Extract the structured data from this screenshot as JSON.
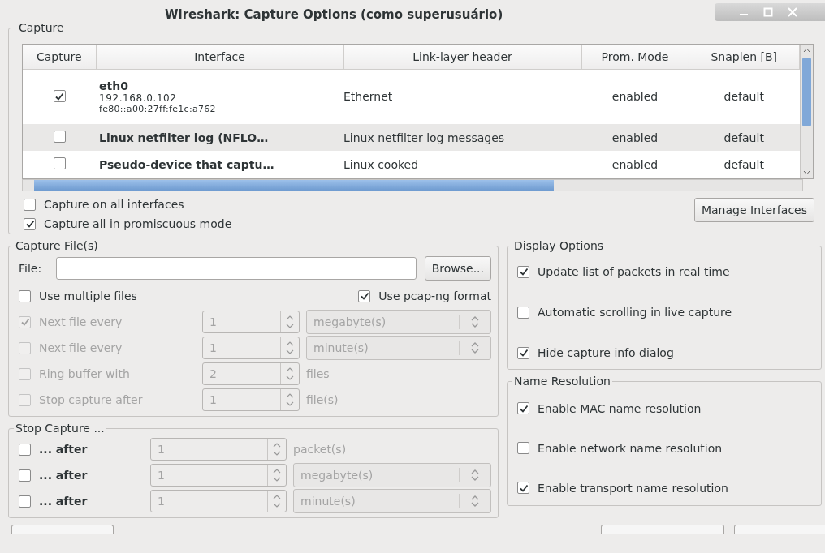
{
  "window": {
    "title": "Wireshark: Capture Options (como superusuário)"
  },
  "capture": {
    "label": "Capture",
    "columns": [
      "Capture",
      "Interface",
      "Link-layer header",
      "Prom. Mode",
      "Snaplen [B]"
    ],
    "rows": [
      {
        "checked": true,
        "interface": "eth0",
        "addresses": [
          "192.168.0.102",
          "fe80::a00:27ff:fe1c:a762"
        ],
        "link_layer": "Ethernet",
        "prom_mode": "enabled",
        "snaplen": "default"
      },
      {
        "checked": false,
        "interface": "Linux netfilter log (NFLO…",
        "addresses": [],
        "link_layer": "Linux netfilter log messages",
        "prom_mode": "enabled",
        "snaplen": "default"
      },
      {
        "checked": false,
        "interface": "Pseudo-device that captu…",
        "addresses": [],
        "link_layer": "Linux cooked",
        "prom_mode": "enabled",
        "snaplen": "default"
      }
    ],
    "options": [
      {
        "label": "Capture on all interfaces",
        "checked": false
      },
      {
        "label": "Capture all in promiscuous mode",
        "checked": true
      }
    ],
    "manage_button": "Manage Interfaces"
  },
  "capture_files": {
    "label": "Capture File(s)",
    "file_label": "File:",
    "browse_button": "Browse...",
    "multiple_files": {
      "label": "Use multiple files",
      "checked": false
    },
    "pcapng": {
      "label": "Use pcap-ng format",
      "checked": true
    },
    "rows": [
      {
        "label": "Next file every",
        "checked": true,
        "disabled": true,
        "spin": {
          "value": "1",
          "disabled": true
        },
        "unit": {
          "kind": "combo",
          "text": "megabyte(s)"
        }
      },
      {
        "label": "Next file every",
        "checked": false,
        "disabled": true,
        "spin": {
          "value": "1",
          "disabled": true
        },
        "unit": {
          "kind": "combo",
          "text": "minute(s)"
        }
      },
      {
        "label": "Ring buffer with",
        "checked": false,
        "disabled": true,
        "spin": {
          "value": "2",
          "disabled": true
        },
        "unit": {
          "kind": "text",
          "text": "files"
        }
      },
      {
        "label": "Stop capture after",
        "checked": false,
        "disabled": true,
        "spin": {
          "value": "1",
          "disabled": true
        },
        "unit": {
          "kind": "text",
          "text": "file(s)"
        }
      }
    ]
  },
  "stop_capture": {
    "label": "Stop Capture ...",
    "rows": [
      {
        "label": "... after",
        "checked": false,
        "disabled": false,
        "spin": {
          "value": "1",
          "disabled": true
        },
        "unit": {
          "kind": "text",
          "text": "packet(s)"
        }
      },
      {
        "label": "... after",
        "checked": false,
        "disabled": false,
        "spin": {
          "value": "1",
          "disabled": true
        },
        "unit": {
          "kind": "combo",
          "text": "megabyte(s)"
        }
      },
      {
        "label": "... after",
        "checked": false,
        "disabled": false,
        "spin": {
          "value": "1",
          "disabled": true
        },
        "unit": {
          "kind": "combo",
          "text": "minute(s)"
        }
      }
    ]
  },
  "display_options": {
    "label": "Display Options",
    "options": [
      {
        "label": "Update list of packets in real time",
        "checked": true
      },
      {
        "label": "Automatic scrolling in live capture",
        "checked": false
      },
      {
        "label": "Hide capture info dialog",
        "checked": true
      }
    ]
  },
  "name_resolution": {
    "label": "Name Resolution",
    "options": [
      {
        "label": "Enable MAC name resolution",
        "checked": true
      },
      {
        "label": "Enable network name resolution",
        "checked": false
      },
      {
        "label": "Enable transport name resolution",
        "checked": true
      }
    ]
  }
}
